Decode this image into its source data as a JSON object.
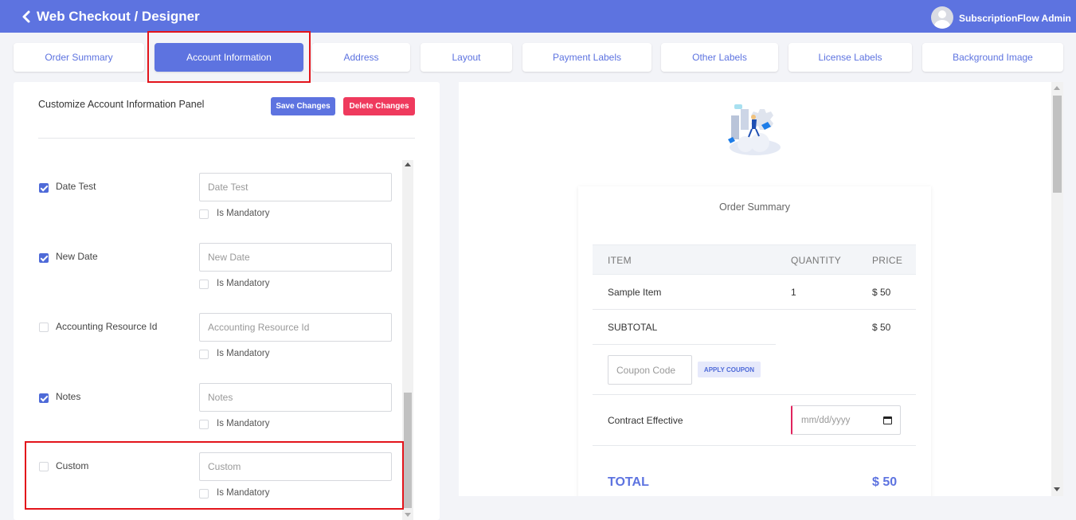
{
  "header": {
    "title": "Web Checkout / Designer",
    "user_name": "SubscriptionFlow Admin",
    "bg_color": "#5d73e0"
  },
  "tabs": [
    {
      "label": "Order Summary"
    },
    {
      "label": "Account Information",
      "active": true
    },
    {
      "label": "Address"
    },
    {
      "label": "Layout"
    },
    {
      "label": "Payment Labels"
    },
    {
      "label": "Other Labels"
    },
    {
      "label": "License Labels"
    },
    {
      "label": "Background Image"
    }
  ],
  "left_panel": {
    "title": "Customize Account Information Panel",
    "save_label": "Save Changes",
    "delete_label": "Delete Changes",
    "fields": [
      {
        "label": "Date Test",
        "checked": true,
        "placeholder": "Date Test",
        "mandatory_label": "Is Mandatory"
      },
      {
        "label": "New Date",
        "checked": true,
        "placeholder": "New Date",
        "mandatory_label": "Is Mandatory"
      },
      {
        "label": "Accounting Resource Id",
        "checked": false,
        "placeholder": "Accounting Resource Id",
        "mandatory_label": "Is Mandatory"
      },
      {
        "label": "Notes",
        "checked": true,
        "placeholder": "Notes",
        "mandatory_label": "Is Mandatory"
      },
      {
        "label": "Custom",
        "checked": false,
        "placeholder": "Custom",
        "mandatory_label": "Is Mandatory"
      }
    ]
  },
  "preview": {
    "card_title": "Order Summary",
    "columns": [
      "ITEM",
      "QUANTITY",
      "PRICE"
    ],
    "item": {
      "name": "Sample Item",
      "quantity": "1",
      "price": "$ 50"
    },
    "subtotal_label": "SUBTOTAL",
    "subtotal_value": "$ 50",
    "coupon_placeholder": "Coupon Code",
    "coupon_button": "APPLY COUPON",
    "contract_label": "Contract Effective",
    "date_placeholder": "mm/dd/yyyy",
    "total_label": "TOTAL",
    "total_value": "$ 50"
  }
}
